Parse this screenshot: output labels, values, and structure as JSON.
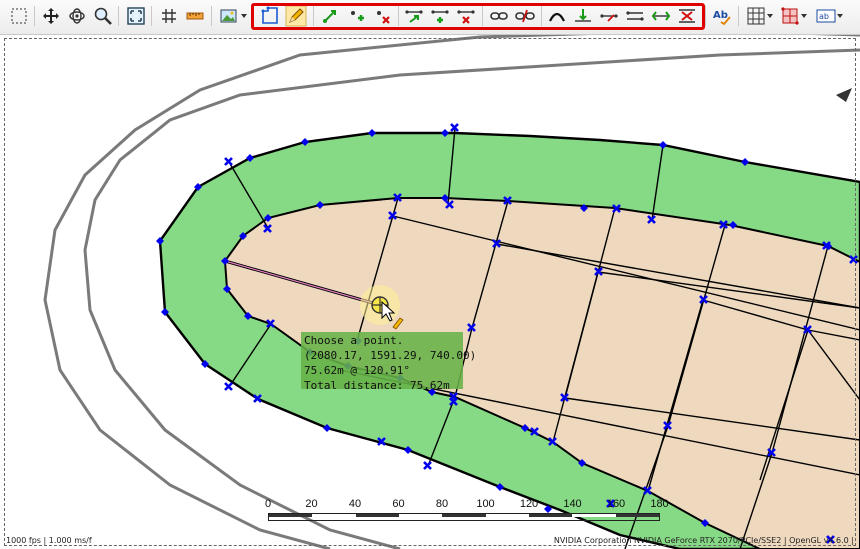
{
  "toolbar": {
    "groups": [
      [
        "select-rectangle-icon",
        "move-icon",
        "orbit-icon",
        "zoom-icon",
        "zoom-extents-icon",
        "grid-icon",
        "ruler-icon",
        "image-icon"
      ],
      [
        "polygon-draw-icon",
        "pencil-icon"
      ],
      [
        "vertex-move-icon",
        "vertex-add-icon",
        "vertex-delete-icon",
        "edge-move-icon",
        "edge-add-icon",
        "edge-delete-icon",
        "link-icon",
        "unlink-icon",
        "curve-icon",
        "edge-split-icon",
        "edge-extend-icon",
        "edge-cut-icon",
        "edge-join-icon",
        "edge-remove-icon"
      ],
      [
        "spellcheck-icon",
        "grid-settings-icon",
        "mesh-icon",
        "label-icon"
      ]
    ],
    "highlight_color": "#e00000"
  },
  "tooltip": {
    "line1": "Choose a point.",
    "line2": "(2080.17, 1591.29, 740.00)",
    "line3": "75.62m @ 120.91°",
    "line4": "Total distance: 75.62m"
  },
  "scalebar": {
    "labels": [
      "0",
      "20",
      "40",
      "60",
      "80",
      "100",
      "120",
      "140",
      "160",
      "180"
    ]
  },
  "status": {
    "left": "1000 fps | 1.000 ms/f",
    "right": "NVIDIA Corporation NVIDIA GeForce RTX 2070/PCIe/SSE2 | OpenGL v4.6.0 |"
  },
  "colors": {
    "green_band": "#86d985",
    "tan_fill": "#eed9bf",
    "vertex_blue": "#0000ee",
    "outline_gray": "#7a7a7a"
  }
}
